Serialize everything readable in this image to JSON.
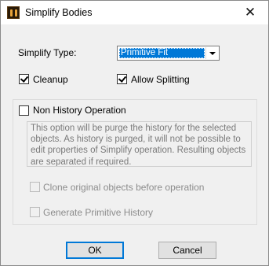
{
  "window": {
    "title": "Simplify Bodies",
    "close_glyph": "✕"
  },
  "simplify_type": {
    "label": "Simplify Type:",
    "selected": "Primitive Fit"
  },
  "options": {
    "cleanup": {
      "label": "Cleanup",
      "checked": true
    },
    "allow_splitting": {
      "label": "Allow Splitting",
      "checked": true
    }
  },
  "non_history": {
    "label": "Non History Operation",
    "checked": false,
    "description": "This option will be purge the  history for the selected objects. As history is purged, it will not be possible to edit properties of Simplify operation. Resulting objects are separated if required.",
    "clone_label": "Clone original objects before operation",
    "generate_label": "Generate Primitive History"
  },
  "buttons": {
    "ok": "OK",
    "cancel": "Cancel"
  },
  "colors": {
    "accent": "#0078d7",
    "dialog_bg": "#f0f0f0"
  },
  "icons": [
    "app-icon",
    "close-icon",
    "dropdown-arrow-icon",
    "checkbox-icon"
  ]
}
